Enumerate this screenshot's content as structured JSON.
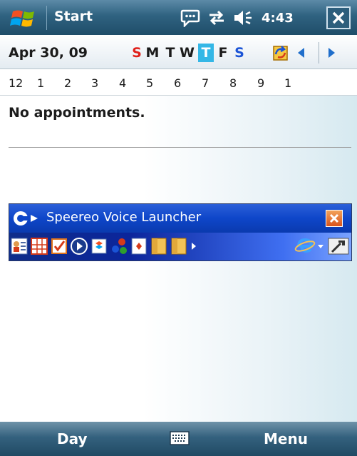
{
  "titlebar": {
    "title": "Start",
    "clock": "4:43"
  },
  "calendar": {
    "date": "Apr 30, 09",
    "weekdays": [
      "S",
      "M",
      "T",
      "W",
      "T",
      "F",
      "S"
    ],
    "today_index": 4,
    "hours": [
      "12",
      "1",
      "2",
      "3",
      "4",
      "5",
      "6",
      "7",
      "8",
      "9",
      "1"
    ],
    "empty_message": "No appointments."
  },
  "launcher": {
    "title": "Speereo Voice Launcher",
    "toolbar_icons": [
      "contacts-icon",
      "calendar-icon",
      "tasks-icon",
      "media-player-icon",
      "messaging-icon",
      "games-icon",
      "solitaire-icon",
      "folder-icon",
      "folder-icon",
      "more-arrow-icon",
      "internet-explorer-icon",
      "settings-icon"
    ]
  },
  "softkeys": {
    "left": "Day",
    "right": "Menu"
  },
  "colors": {
    "title_bar": "#2f6280",
    "today_highlight": "#34b7e6",
    "weekend_red": "#e0201a",
    "weekend_blue": "#1a53d6",
    "launcher_blue": "#0e46c9"
  }
}
